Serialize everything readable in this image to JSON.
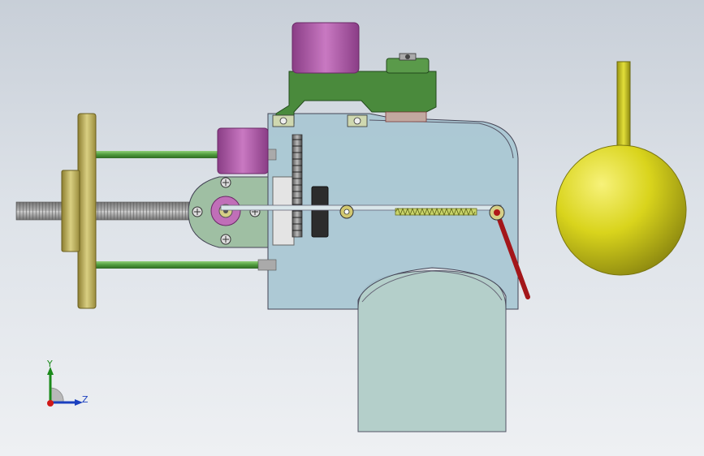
{
  "viewport": {
    "background_top": "#c8cfd8",
    "background_bottom": "#eef0f3"
  },
  "triad": {
    "y_label": "Y",
    "z_label": "Z",
    "y_color": "#1a8a1a",
    "z_color": "#1a3fbf",
    "x_color": "#d01818"
  },
  "colors": {
    "housing": "#a9c8d3",
    "housing_lower": "#b2cdc9",
    "motor": "#b060a8",
    "bracket": "#4a8a3c",
    "rod": "#5fa04a",
    "flange": "#b8a850",
    "float_ball": "#d6d21a",
    "lever": "#b01818",
    "screw": "#8a8a8a"
  }
}
